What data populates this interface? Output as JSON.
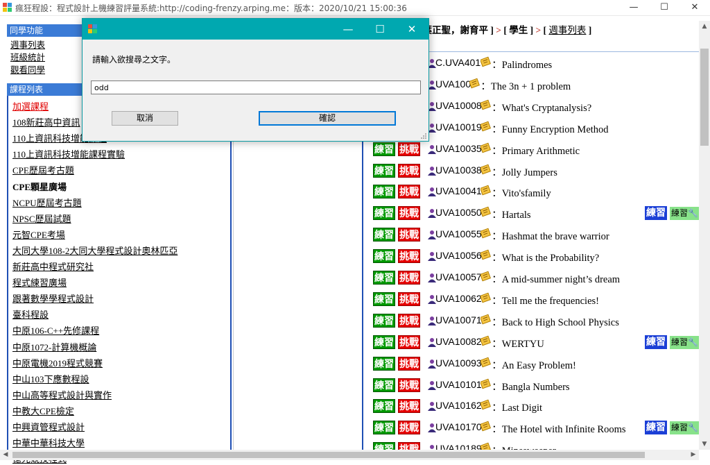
{
  "window": {
    "title": "瘋狂程設：程式設計上機練習評量系統:http://coding-frenzy.arping.me：版本：2020/10/21 15:00:36",
    "minimize": "—",
    "maximize": "☐",
    "close": "✕"
  },
  "left_panel": {
    "functions_header": "同學功能",
    "functions": [
      "週事列表",
      "班級統計",
      "觀看同學"
    ],
    "courses_header": "課程列表",
    "courses": [
      "加選課程",
      "108新莊高中資訊",
      "110上資訊科技增能課程",
      "110上資訊科技增能課程實驗",
      "CPE歷屆考古題",
      "CPE顆星廣場",
      "NCPU歷屆考古題",
      "NPSC歷屆試題",
      "元智CPE考場",
      "大同大學108-2大同大學程式設計奧林匹亞",
      "新莊高中程式研究社",
      "程式練習廣場",
      "跟著數學學程式設計",
      "臺科程設",
      "中原106-C++先修課程",
      "中原1072-計算機概論",
      "中原電機2019程式競賽",
      "中山103下應數程設",
      "中山高等程式設計與實作",
      "中教大CPE檢定",
      "中興資管程式設計",
      "中華中華科技大學",
      "億光競技程式"
    ]
  },
  "breadcrumb": {
    "people": "，葉正聖，謝育平 ]",
    "sep1": " > ",
    "role": "[ 學生 ]",
    "sep2": " > ",
    "open_bracket": "[ ",
    "page": "週事列表",
    "close_bracket": " ]"
  },
  "problem_buttons": {
    "practice": "練習",
    "challenge": "挑戰",
    "done": "練習"
  },
  "problems": [
    {
      "id": "C.UVA401",
      "name": "Palindromes",
      "buttons": false,
      "status": false
    },
    {
      "id": "UVA100",
      "name": "The 3n + 1 problem",
      "buttons": false,
      "status": false
    },
    {
      "id": "UVA10008",
      "name": "What's Cryptanalysis?",
      "buttons": false,
      "status": false
    },
    {
      "id": "UVA10019",
      "name": "Funny Encryption Method",
      "buttons": false,
      "status": false
    },
    {
      "id": "UVA10035",
      "name": "Primary Arithmetic",
      "buttons": true,
      "status": false
    },
    {
      "id": "UVA10038",
      "name": "Jolly Jumpers",
      "buttons": true,
      "status": false
    },
    {
      "id": "UVA10041",
      "name": "Vito'sfamily",
      "buttons": true,
      "status": false
    },
    {
      "id": "UVA10050",
      "name": "Hartals",
      "buttons": true,
      "status": true
    },
    {
      "id": "UVA10055",
      "name": "Hashmat the brave warrior",
      "buttons": true,
      "status": false
    },
    {
      "id": "UVA10056",
      "name": "What is the Probability?",
      "buttons": true,
      "status": false
    },
    {
      "id": "UVA10057",
      "name": "A mid-summer night’s dream",
      "buttons": true,
      "status": false
    },
    {
      "id": "UVA10062",
      "name": "Tell me the frequencies!",
      "buttons": true,
      "status": false
    },
    {
      "id": "UVA10071",
      "name": "Back to High School Physics",
      "buttons": true,
      "status": false
    },
    {
      "id": "UVA10082",
      "name": "WERTYU",
      "buttons": true,
      "status": true
    },
    {
      "id": "UVA10093",
      "name": "An Easy Problem!",
      "buttons": true,
      "status": false
    },
    {
      "id": "UVA10101",
      "name": "Bangla Numbers",
      "buttons": true,
      "status": false
    },
    {
      "id": "UVA10162",
      "name": "Last Digit",
      "buttons": true,
      "status": false
    },
    {
      "id": "UVA10170",
      "name": "The Hotel with Infinite Rooms",
      "buttons": true,
      "status": true
    },
    {
      "id": "UVA10189",
      "name": "Minesweeper",
      "buttons": true,
      "status": false
    }
  ],
  "dialog": {
    "prompt": "請輸入欲搜尋之文字。",
    "input_value": "odd",
    "cancel_label": "取消",
    "ok_label": "確認",
    "minimize": "—",
    "maximize": "☐",
    "close": "✕"
  },
  "colors": {
    "practice_green": "#009900",
    "challenge_red": "#e60000",
    "header_blue": "#3b7bd6",
    "dialog_teal": "#00a8b0"
  }
}
